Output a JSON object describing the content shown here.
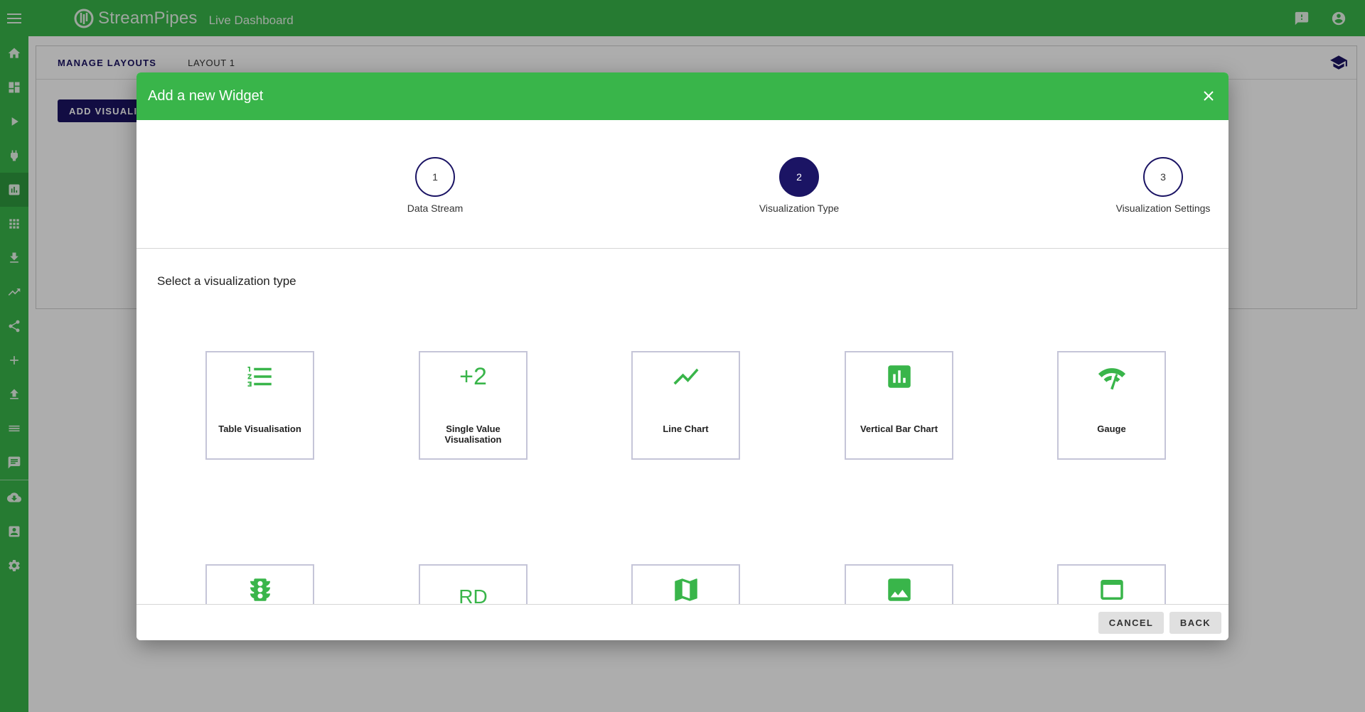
{
  "topbar": {
    "brand_name": "StreamPipes",
    "page_title": "Live Dashboard",
    "icons": [
      "menu-icon",
      "feedback-icon",
      "account-icon"
    ]
  },
  "sidebar": {
    "items": [
      {
        "icon": "home-icon"
      },
      {
        "icon": "dashboard-icon"
      },
      {
        "icon": "play-icon"
      },
      {
        "icon": "plug-icon"
      },
      {
        "icon": "bar-chart-icon",
        "active": true
      },
      {
        "icon": "apps-icon"
      },
      {
        "icon": "download-icon"
      },
      {
        "icon": "trending-up-icon"
      },
      {
        "icon": "share-icon"
      },
      {
        "icon": "add-icon"
      },
      {
        "icon": "upload-icon"
      },
      {
        "icon": "list-icon"
      },
      {
        "icon": "chat-icon"
      },
      {
        "icon": "cloud-download-icon"
      },
      {
        "icon": "contact-icon"
      },
      {
        "icon": "settings-icon"
      }
    ]
  },
  "main": {
    "tabs": [
      {
        "label": "MANAGE LAYOUTS"
      },
      {
        "label": "LAYOUT 1"
      }
    ],
    "add_button_label": "ADD VISUALIZATION"
  },
  "dialog": {
    "title": "Add a new Widget",
    "steps": [
      {
        "number": "1",
        "label": "Data Stream"
      },
      {
        "number": "2",
        "label": "Visualization Type",
        "active": true
      },
      {
        "number": "3",
        "label": "Visualization Settings"
      }
    ],
    "section_title": "Select a visualization type",
    "visualizations": [
      {
        "label": "Table Visualisation",
        "icon": "format-list-numbered-icon"
      },
      {
        "label": "Single Value Visualisation",
        "icon": "plus-two-text-icon",
        "icon_text": "+2"
      },
      {
        "label": "Line Chart",
        "icon": "show-chart-icon"
      },
      {
        "label": "Vertical Bar Chart",
        "icon": "insert-chart-icon"
      },
      {
        "label": "Gauge",
        "icon": "gauge-icon"
      },
      {
        "label": "",
        "icon": "traffic-light-icon"
      },
      {
        "label": "",
        "icon": "rd-text-icon",
        "icon_text": "RD"
      },
      {
        "label": "",
        "icon": "map-icon"
      },
      {
        "label": "",
        "icon": "image-icon"
      },
      {
        "label": "",
        "icon": "web-window-icon"
      }
    ],
    "buttons": {
      "cancel": "CANCEL",
      "back": "BACK"
    }
  },
  "colors": {
    "primary_green": "#39b54a",
    "navy": "#1b1464",
    "overlay": "rgba(0,0,0,0.32)"
  }
}
